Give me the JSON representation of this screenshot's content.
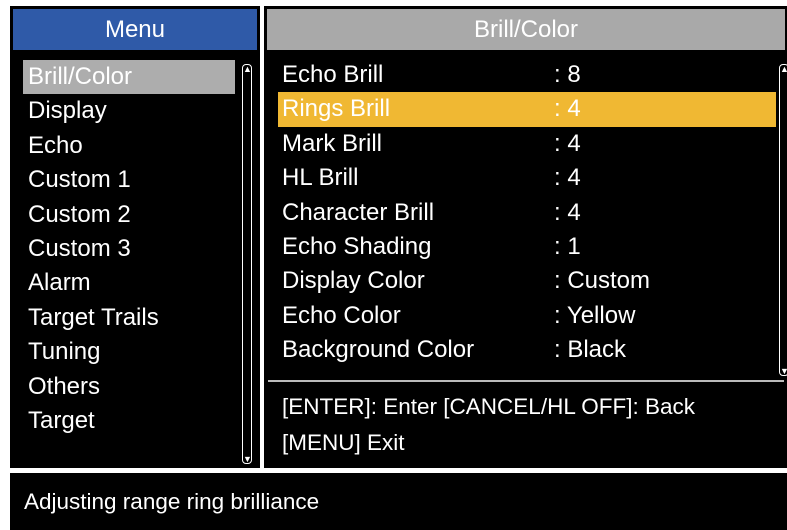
{
  "menu": {
    "title": "Menu",
    "items": [
      {
        "label": "Brill/Color",
        "selected": true
      },
      {
        "label": "Display",
        "selected": false
      },
      {
        "label": "Echo",
        "selected": false
      },
      {
        "label": "Custom 1",
        "selected": false
      },
      {
        "label": "Custom 2",
        "selected": false
      },
      {
        "label": "Custom 3",
        "selected": false
      },
      {
        "label": "Alarm",
        "selected": false
      },
      {
        "label": "Target Trails",
        "selected": false
      },
      {
        "label": "Tuning",
        "selected": false
      },
      {
        "label": "Others",
        "selected": false
      },
      {
        "label": "Target",
        "selected": false
      }
    ]
  },
  "content": {
    "title": "Brill/Color",
    "rows": [
      {
        "label": "Echo Brill",
        "value": ": 8",
        "selected": false
      },
      {
        "label": "Rings Brill",
        "value": ": 4",
        "selected": true
      },
      {
        "label": "Mark Brill",
        "value": ": 4",
        "selected": false
      },
      {
        "label": "HL Brill",
        "value": ": 4",
        "selected": false
      },
      {
        "label": "Character Brill",
        "value": ": 4",
        "selected": false
      },
      {
        "label": "Echo Shading",
        "value": ": 1",
        "selected": false
      },
      {
        "label": "Display Color",
        "value": ": Custom",
        "selected": false
      },
      {
        "label": "Echo Color",
        "value": ": Yellow",
        "selected": false
      },
      {
        "label": "Background Color",
        "value": ": Black",
        "selected": false
      }
    ],
    "hint_line_1": "[ENTER]: Enter [CANCEL/HL OFF]: Back",
    "hint_line_2": "[MENU] Exit"
  },
  "status": {
    "text": "Adjusting range ring brilliance"
  },
  "colors": {
    "menu_header": "#2f5aa8",
    "content_header": "#a9a9a9",
    "menu_selection": "#adadad",
    "row_selection": "#f0b833",
    "panel_background": "#000000"
  },
  "icons": {
    "scroll_up": "scroll-up-arrow-icon",
    "scroll_down": "scroll-down-arrow-icon"
  }
}
